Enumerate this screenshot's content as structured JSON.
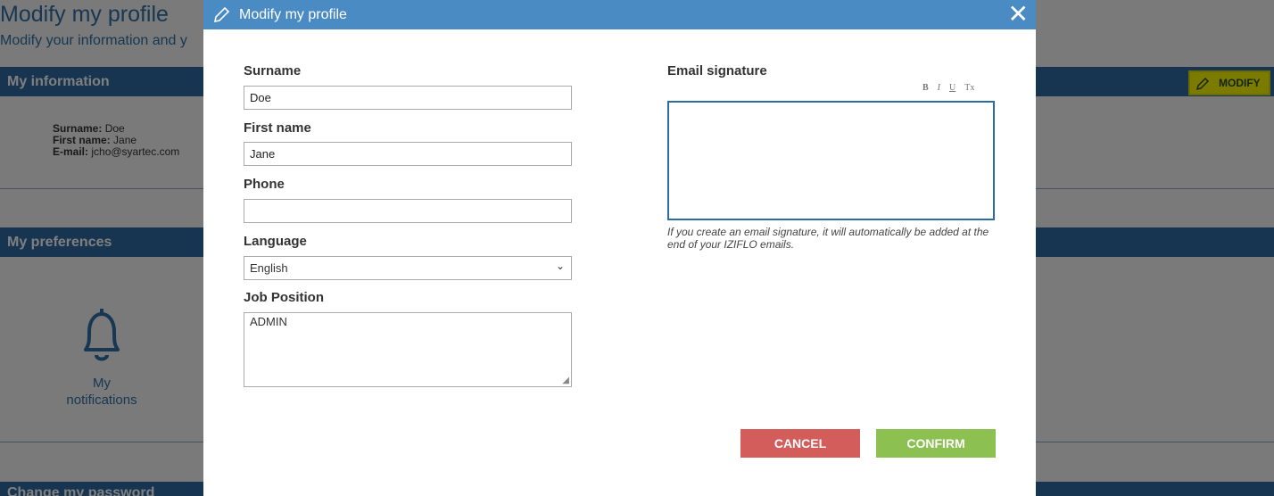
{
  "page": {
    "title": "Modify my profile",
    "subtitle": "Modify your information and y",
    "sections": {
      "information": "My information",
      "preferences": "My preferences",
      "password": "Change my password"
    },
    "info": {
      "surname_label": "Surname:",
      "surname_value": "Doe",
      "firstname_label": "First name:",
      "firstname_value": "Jane",
      "email_label": "E-mail:",
      "email_value": "jcho@syartec.com"
    },
    "notifications_label": "My\nnotifications",
    "modify_button": "MODIFY",
    "highlight_color": "#f7f700"
  },
  "modal": {
    "title": "Modify my profile",
    "close": "✕",
    "fields": {
      "surname_label": "Surname",
      "surname_value": "Doe",
      "firstname_label": "First name",
      "firstname_value": "Jane",
      "phone_label": "Phone",
      "phone_value": "",
      "language_label": "Language",
      "language_value": "English",
      "job_label": "Job Position",
      "job_value": "ADMIN"
    },
    "signature": {
      "label": "Email signature",
      "toolbar": [
        "B",
        "I",
        "U",
        "Tx"
      ],
      "help": "If you create an email signature, it will automatically be added at the end of your IZIFLO emails."
    },
    "buttons": {
      "cancel": "CANCEL",
      "confirm": "CONFIRM"
    },
    "colors": {
      "header": "#4a8bc4",
      "cancel": "#d35d5a",
      "confirm": "#8cc152"
    }
  }
}
